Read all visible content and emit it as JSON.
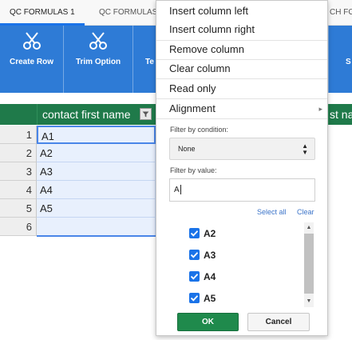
{
  "tabs": [
    {
      "label": "QC FORMULAS 1",
      "active": true
    },
    {
      "label": "QC FORMULAS"
    },
    {
      "label": "CH FO"
    }
  ],
  "toolbar": {
    "buttons": [
      {
        "label": "Create Row",
        "icon": "scissors-icon"
      },
      {
        "label": "Trim Option",
        "icon": "scissors-icon"
      },
      {
        "label": "Te"
      },
      {
        "label": "S"
      }
    ]
  },
  "sheet": {
    "column_headers": [
      "contact first name",
      "st na"
    ],
    "row_numbers": [
      "1",
      "2",
      "3",
      "4",
      "5",
      "6"
    ],
    "cells": [
      "A1",
      "A2",
      "A3",
      "A4",
      "A5",
      ""
    ]
  },
  "menu": {
    "items": [
      {
        "label": "Insert column left"
      },
      {
        "label": "Insert column right"
      },
      {
        "label": "Remove column"
      },
      {
        "label": "Clear column"
      },
      {
        "label": "Read only"
      },
      {
        "label": "Alignment",
        "arrow": "▸"
      }
    ],
    "filter_condition": {
      "label": "Filter by condition:",
      "value": "None",
      "up": "▲",
      "down": "▼"
    },
    "filter_value": {
      "label": "Filter by value:",
      "input": "A",
      "select_all": "Select all",
      "clear": "Clear",
      "options": [
        {
          "label": "A2",
          "checked": true
        },
        {
          "label": "A3",
          "checked": true
        },
        {
          "label": "A4",
          "checked": true
        },
        {
          "label": "A5",
          "checked": true
        }
      ],
      "scroll_up": "▲",
      "scroll_down": "▼"
    },
    "ok_label": "OK",
    "cancel_label": "Cancel"
  },
  "colors": {
    "toolbar": "#2e7bd6",
    "header": "#1f7a4a",
    "ok": "#1f8a4c",
    "checkbox": "#1a73e8",
    "link": "#3b74c9"
  }
}
